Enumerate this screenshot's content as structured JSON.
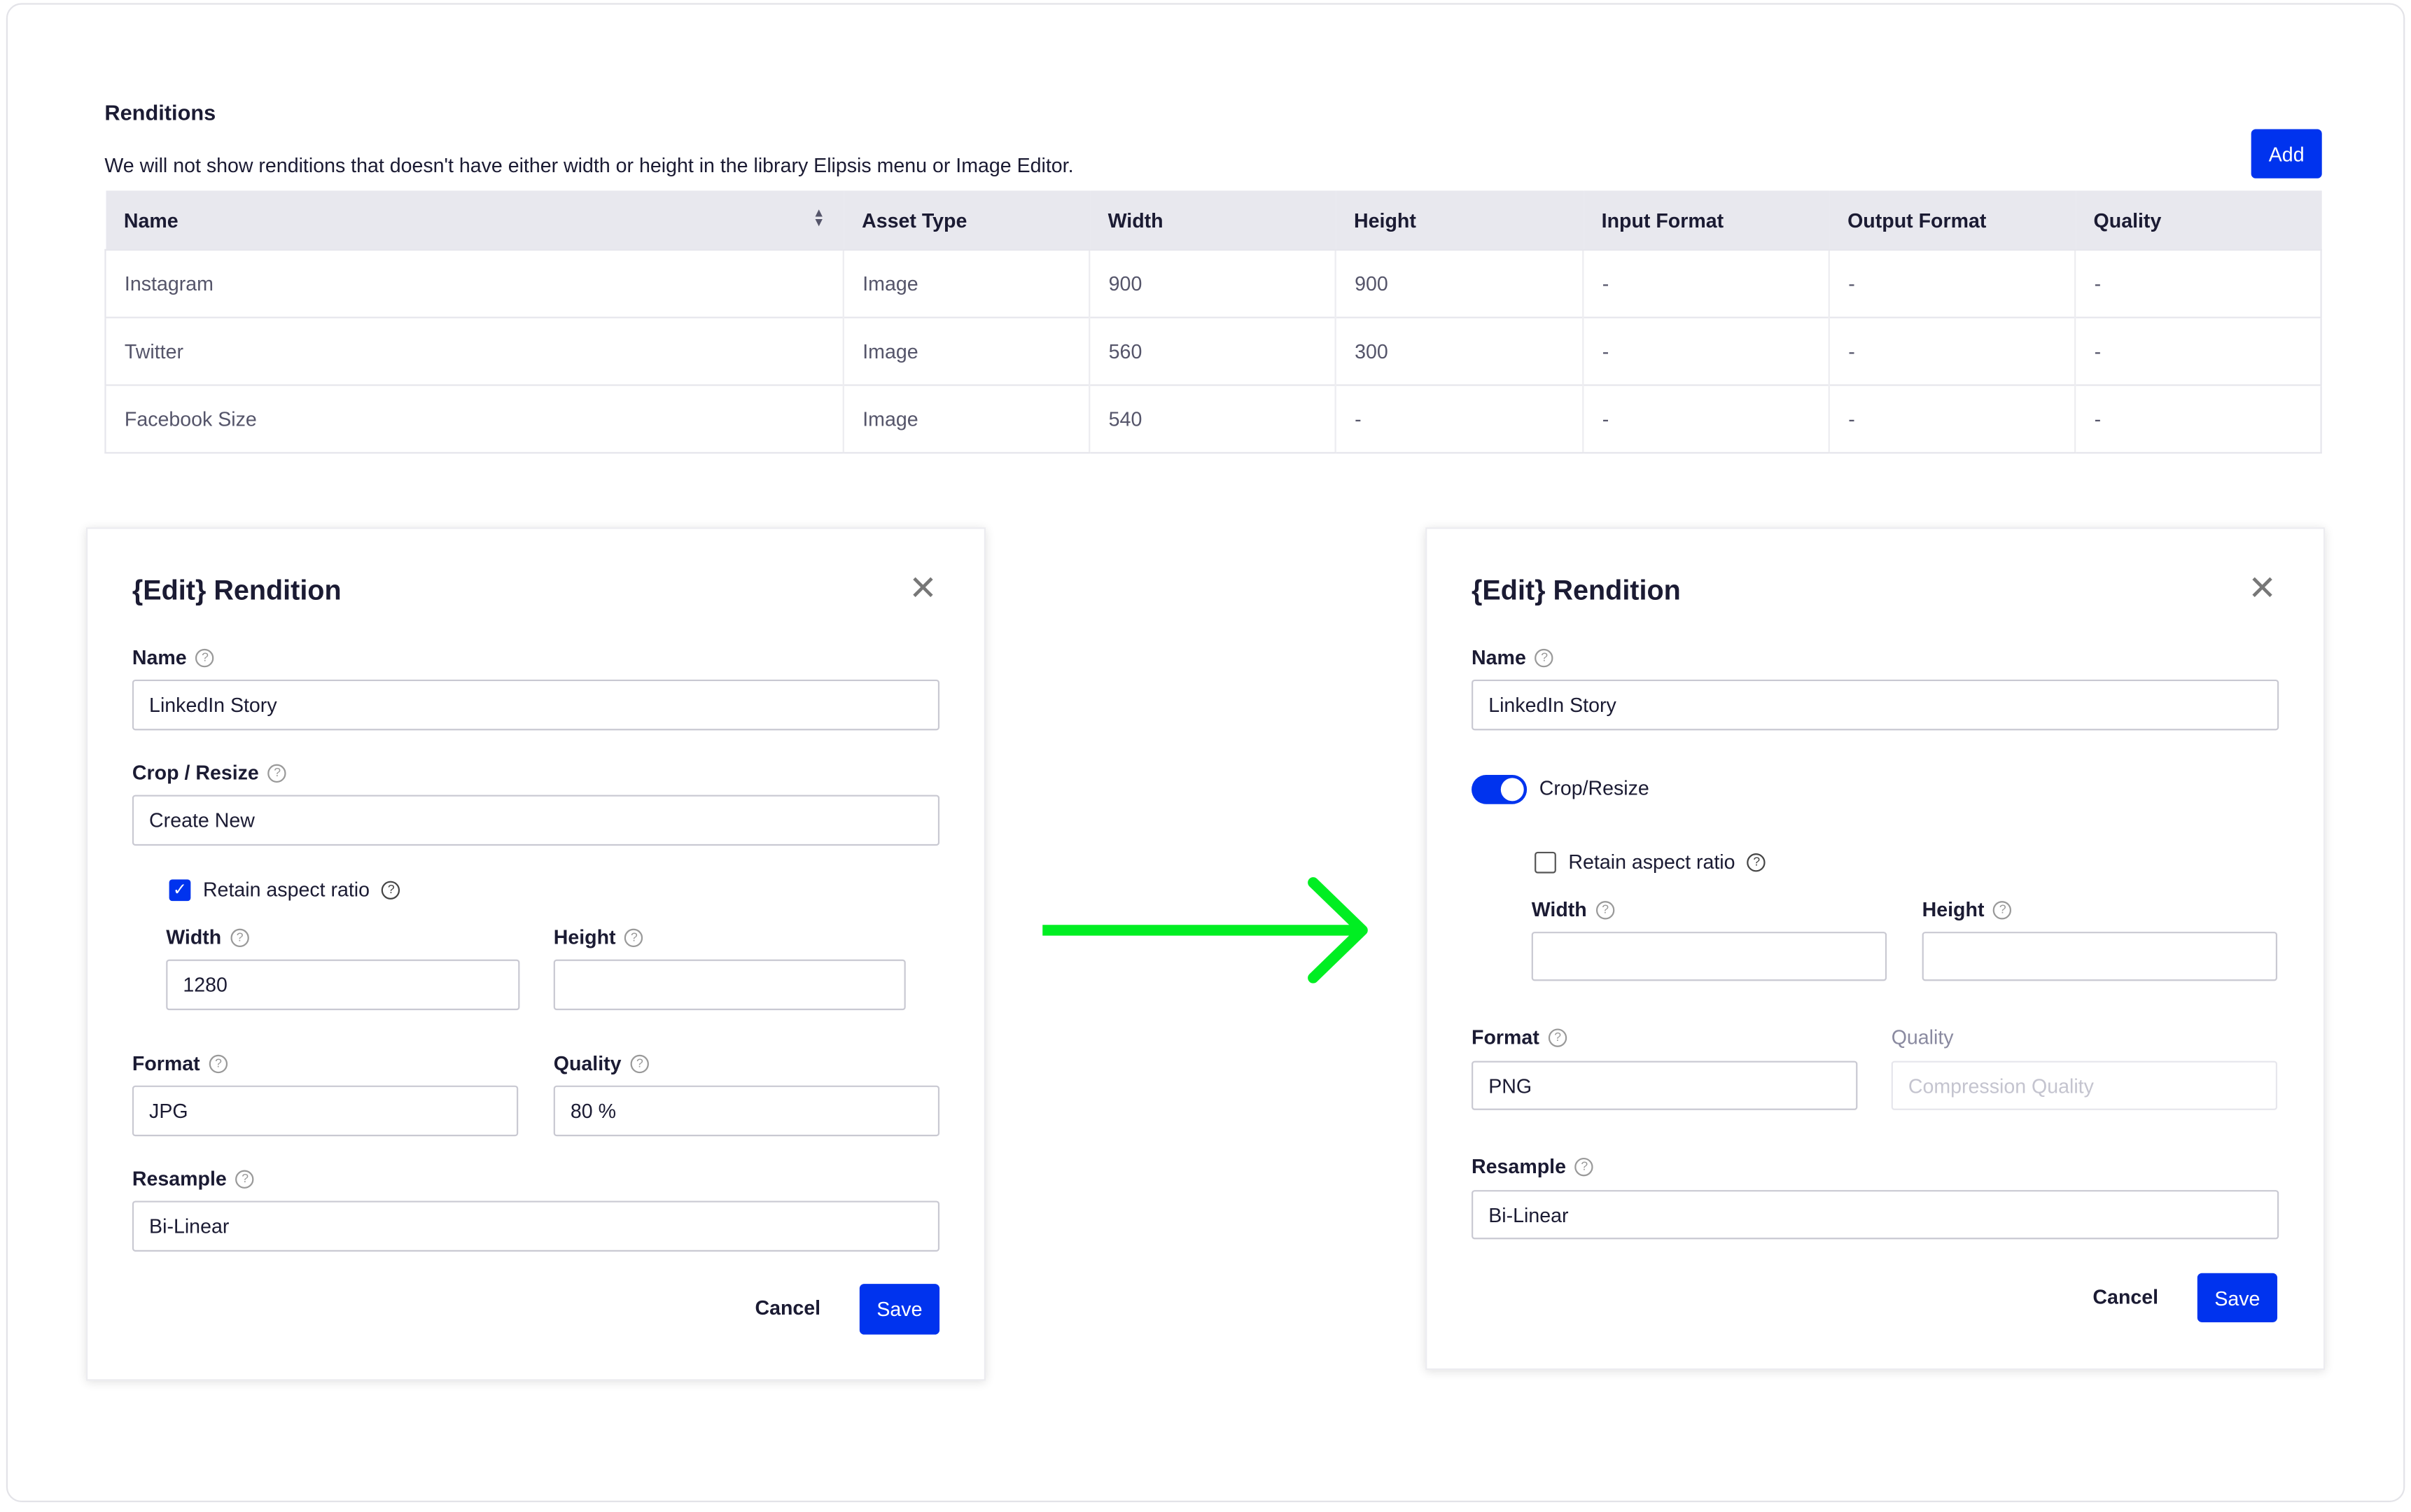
{
  "renditions": {
    "title": "Renditions",
    "description": "We will not show renditions that doesn't have either width or height in the library Elipsis menu or Image Editor.",
    "add_label": "Add",
    "columns": [
      "Name",
      "Asset Type",
      "Width",
      "Height",
      "Input Format",
      "Output Format",
      "Quality"
    ],
    "rows": [
      [
        "Instagram",
        "Image",
        "900",
        "900",
        "-",
        "-",
        "-"
      ],
      [
        "Twitter",
        "Image",
        "560",
        "300",
        "-",
        "-",
        "-"
      ],
      [
        "Facebook Size",
        "Image",
        "540",
        "-",
        "-",
        "-",
        "-"
      ]
    ]
  },
  "left_dialog": {
    "title": "{Edit} Rendition",
    "name_label": "Name",
    "name_value": "LinkedIn Story",
    "crop_label": "Crop / Resize",
    "crop_value": "Create New",
    "retain_label": "Retain aspect ratio",
    "retain_checked": true,
    "width_label": "Width",
    "width_value": "1280",
    "height_label": "Height",
    "height_value": "",
    "format_label": "Format",
    "format_value": "JPG",
    "quality_label": "Quality",
    "quality_value": "80 %",
    "resample_label": "Resample",
    "resample_value": "Bi-Linear",
    "cancel_label": "Cancel",
    "save_label": "Save"
  },
  "right_dialog": {
    "title": "{Edit} Rendition",
    "name_label": "Name",
    "name_value": "LinkedIn Story",
    "crop_toggle_label": "Crop/Resize",
    "crop_toggle_on": true,
    "retain_label": "Retain aspect ratio",
    "retain_checked": false,
    "width_label": "Width",
    "height_label": "Height",
    "format_label": "Format",
    "format_value": "PNG",
    "quality_label": "Quality",
    "quality_placeholder": "Compression Quality",
    "resample_label": "Resample",
    "resample_value": "Bi-Linear",
    "cancel_label": "Cancel",
    "save_label": "Save"
  },
  "colors": {
    "accent": "#0033ee",
    "arrow": "#00ee22",
    "header_bg": "#e8e8ee"
  },
  "icons": {
    "help": "question-circle-icon",
    "close": "close-icon",
    "sort": "sort-icon",
    "arrow": "arrow-right-icon"
  }
}
